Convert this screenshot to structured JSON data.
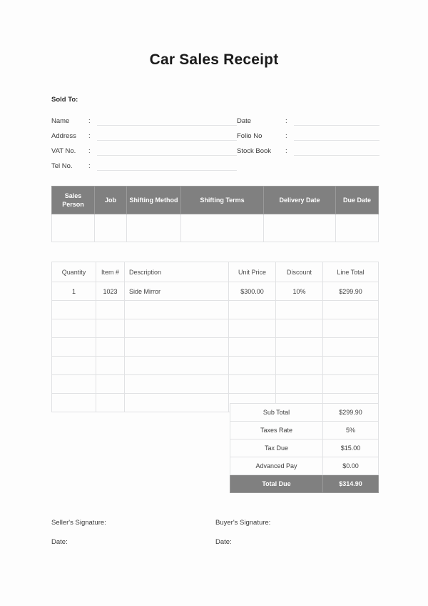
{
  "document": {
    "title": "Car Sales Receipt"
  },
  "sold_to": {
    "heading": "Sold To:",
    "colon": ":",
    "left_fields": [
      {
        "label": "Name",
        "value": ""
      },
      {
        "label": "Address",
        "value": ""
      },
      {
        "label": "VAT No.",
        "value": ""
      },
      {
        "label": "Tel No.",
        "value": ""
      }
    ],
    "right_fields": [
      {
        "label": "Date",
        "value": ""
      },
      {
        "label": "Folio No",
        "value": ""
      },
      {
        "label": "Stock Book",
        "value": ""
      }
    ]
  },
  "sales_table": {
    "headers": [
      "Sales Person",
      "Job",
      "Shifting Method",
      "Shifting Terms",
      "Delivery Date",
      "Due Date"
    ],
    "rows": [
      [
        "",
        "",
        "",
        "",
        "",
        ""
      ]
    ]
  },
  "items_table": {
    "headers": [
      "Quantity",
      "Item #",
      "Description",
      "Unit Price",
      "Discount",
      "Line Total"
    ],
    "rows": [
      [
        "1",
        "1023",
        "Side Mirror",
        "$300.00",
        "10%",
        "$299.90"
      ],
      [
        "",
        "",
        "",
        "",
        "",
        ""
      ],
      [
        "",
        "",
        "",
        "",
        "",
        ""
      ],
      [
        "",
        "",
        "",
        "",
        "",
        ""
      ],
      [
        "",
        "",
        "",
        "",
        "",
        ""
      ],
      [
        "",
        "",
        "",
        "",
        "",
        ""
      ],
      [
        "",
        "",
        "",
        "",
        "",
        ""
      ]
    ]
  },
  "totals": [
    {
      "label": "Sub Total",
      "value": "$299.90",
      "emphasis": false
    },
    {
      "label": "Taxes Rate",
      "value": "5%",
      "emphasis": false
    },
    {
      "label": "Tax Due",
      "value": "$15.00",
      "emphasis": false
    },
    {
      "label": "Advanced Pay",
      "value": "$0.00",
      "emphasis": false
    },
    {
      "label": "Total Due",
      "value": "$314.90",
      "emphasis": true
    }
  ],
  "signatures": {
    "seller_label": "Seller's Signature:",
    "seller_date_label": "Date:",
    "buyer_label": "Buyer's Signature:",
    "buyer_date_label": "Date:"
  },
  "colors": {
    "header_gray": "#808080",
    "page_background": "#fdfdfd",
    "grid_line": "#e1e2e4",
    "field_underline": "#e3e4e6",
    "text": "#3f3f3f"
  }
}
